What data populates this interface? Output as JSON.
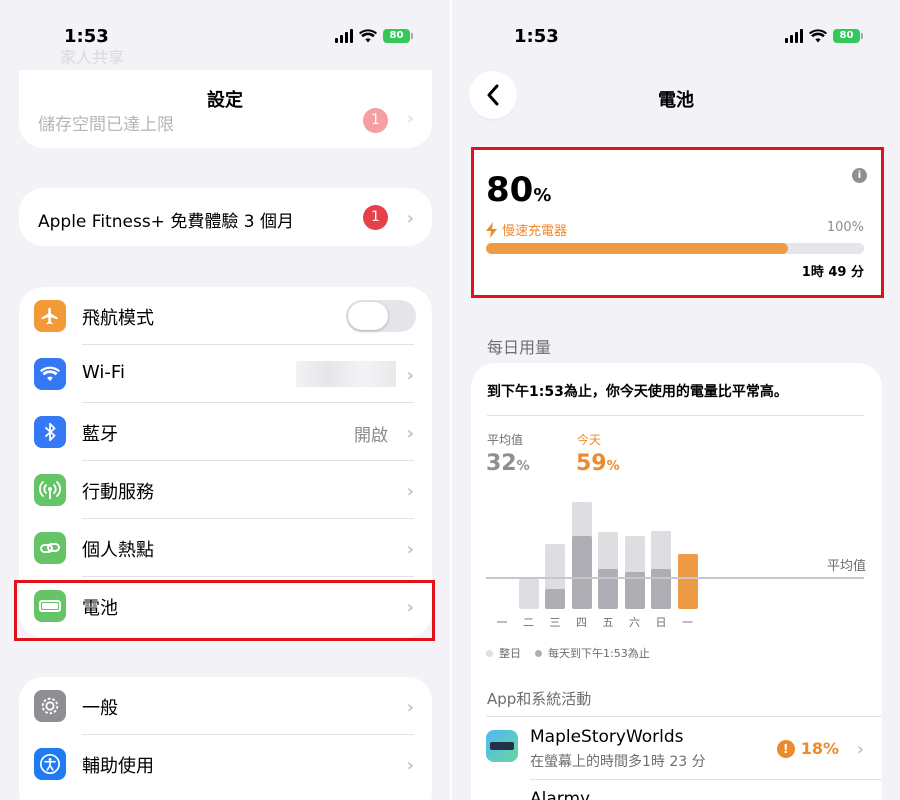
{
  "status_bar": {
    "time": "1:53",
    "battery": "80"
  },
  "left": {
    "title": "設定",
    "blurred_top": "家人共享",
    "storage_row": {
      "label": "儲存空間已達上限",
      "badge": "1"
    },
    "fitness_row": {
      "label": "Apple Fitness+ 免費體驗 3 個月",
      "badge": "1"
    },
    "connectivity": [
      {
        "label": "飛航模式",
        "icon": "airplane-icon",
        "color": "#f19a37"
      },
      {
        "label": "Wi-Fi",
        "icon": "wifi-icon",
        "color": "#3478f6"
      },
      {
        "label": "藍牙",
        "value": "開啟",
        "icon": "bluetooth-icon",
        "color": "#3478f6"
      },
      {
        "label": "行動服務",
        "icon": "antenna-icon",
        "color": "#65c466"
      },
      {
        "label": "個人熱點",
        "icon": "hotspot-icon",
        "color": "#65c466"
      },
      {
        "label": "電池",
        "icon": "battery-icon",
        "color": "#65c466"
      }
    ],
    "general": [
      {
        "label": "一般",
        "icon": "gear-icon",
        "color": "#8e8e93"
      },
      {
        "label": "輔助使用",
        "icon": "accessibility-icon",
        "color": "#1e7bf2"
      }
    ],
    "airplane_toggle": false
  },
  "right": {
    "title": "電池",
    "level": {
      "value": "80",
      "unit": "%",
      "charger_label": "慢速充電器",
      "full_label": "100%",
      "fill": 0.8,
      "time_to_full": "1時 49 分"
    },
    "daily_usage_header": "每日用量",
    "summary": "到下午1:53為止，你今天使用的電量比平常高。",
    "avg": {
      "label": "平均值",
      "value": "32",
      "unit": "%"
    },
    "today": {
      "label": "今天",
      "value": "59",
      "unit": "%"
    },
    "avg_line_label": "平均值",
    "legend": {
      "full": "整日",
      "partial": "每天到下午1:53為止"
    },
    "app_activity_header": "App和系統活動",
    "app": {
      "name": "MapleStoryWorlds",
      "detail": "在螢幕上的時間多1時 23 分",
      "percent": "18%"
    },
    "app_next": "Alarmy"
  },
  "chart_data": {
    "type": "bar",
    "categories": [
      "一",
      "二",
      "三",
      "四",
      "五",
      "六",
      "日",
      "一"
    ],
    "series": [
      {
        "name": "整日",
        "values": [
          0,
          30,
          65,
          107,
          77,
          73,
          78,
          55
        ]
      },
      {
        "name": "每天到下午1:53為止",
        "values": [
          0,
          0,
          20,
          73,
          40,
          37,
          40,
          55
        ]
      }
    ],
    "avg_line": 30,
    "highlight_last": true,
    "colors": {
      "full": "#dedee2",
      "partial": "#aeaeb4",
      "today": "#ee9a46",
      "avg_line": "#c7c7cc"
    }
  },
  "colors": {
    "accent_orange": "#ee8a2e",
    "badge_red": "#e8404a",
    "highlight_red": "#e0121c"
  }
}
